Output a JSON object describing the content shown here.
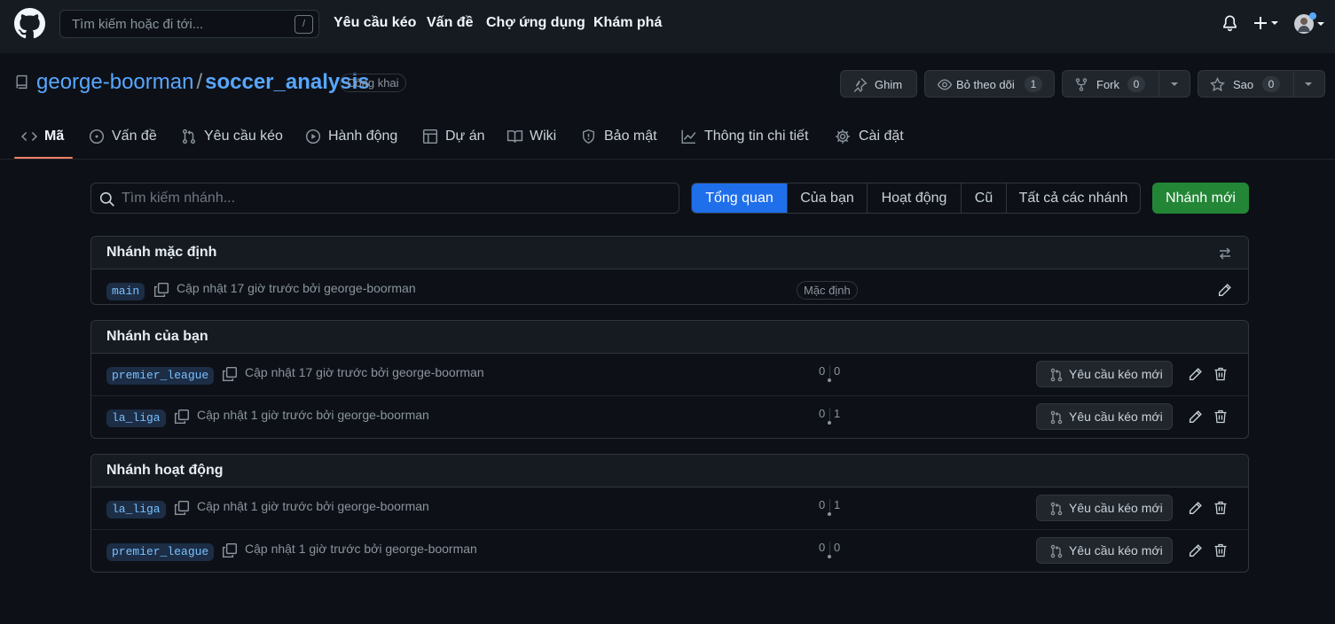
{
  "header": {
    "search_placeholder": "Tìm kiếm hoặc đi tới...",
    "search_shortcut": "/",
    "nav": [
      "Yêu cầu kéo",
      "Vấn đề",
      "Chợ ứng dụng",
      "Khám phá"
    ]
  },
  "repo": {
    "owner": "george-boorman",
    "separator": "/",
    "name": "soccer_analysis",
    "visibility": "Công khai",
    "pin_label": "Ghim",
    "watch_label": "Bỏ theo dõi",
    "watch_count": "1",
    "fork_label": "Fork",
    "fork_count": "0",
    "star_label": "Sao",
    "star_count": "0"
  },
  "tabs": [
    "Mã",
    "Vấn đề",
    "Yêu cầu kéo",
    "Hành động",
    "Dự án",
    "Wiki",
    "Bảo mật",
    "Thông tin chi tiết",
    "Cài đặt"
  ],
  "branches_page": {
    "search_placeholder": "Tìm kiếm nhánh...",
    "filters": [
      "Tổng quan",
      "Của bạn",
      "Hoạt động",
      "Cũ",
      "Tất cả các nhánh"
    ],
    "active_filter": "Tổng quan",
    "new_branch_label": "Nhánh mới",
    "new_pr_label": "Yêu cầu kéo mới",
    "default_badge": "Mặc định",
    "sections": [
      {
        "title": "Nhánh mặc định",
        "rows": [
          {
            "name": "main",
            "updated": "Cập nhật 17 giờ trước bởi george-boorman"
          }
        ]
      },
      {
        "title": "Nhánh của bạn",
        "rows": [
          {
            "name": "premier_league",
            "updated": "Cập nhật 17 giờ trước bởi george-boorman",
            "behind": "0",
            "ahead": "0"
          },
          {
            "name": "la_liga",
            "updated": "Cập nhật 1 giờ trước bởi george-boorman",
            "behind": "0",
            "ahead": "1"
          }
        ]
      },
      {
        "title": "Nhánh hoạt động",
        "rows": [
          {
            "name": "la_liga",
            "updated": "Cập nhật 1 giờ trước bởi george-boorman",
            "behind": "0",
            "ahead": "1"
          },
          {
            "name": "premier_league",
            "updated": "Cập nhật 1 giờ trước bởi george-boorman",
            "behind": "0",
            "ahead": "0"
          }
        ]
      }
    ]
  },
  "colors": {
    "accent": "#1f6feb",
    "success": "#238636",
    "link": "#58a6ff",
    "tab_underline": "#f78166",
    "background": "#0d1117"
  }
}
